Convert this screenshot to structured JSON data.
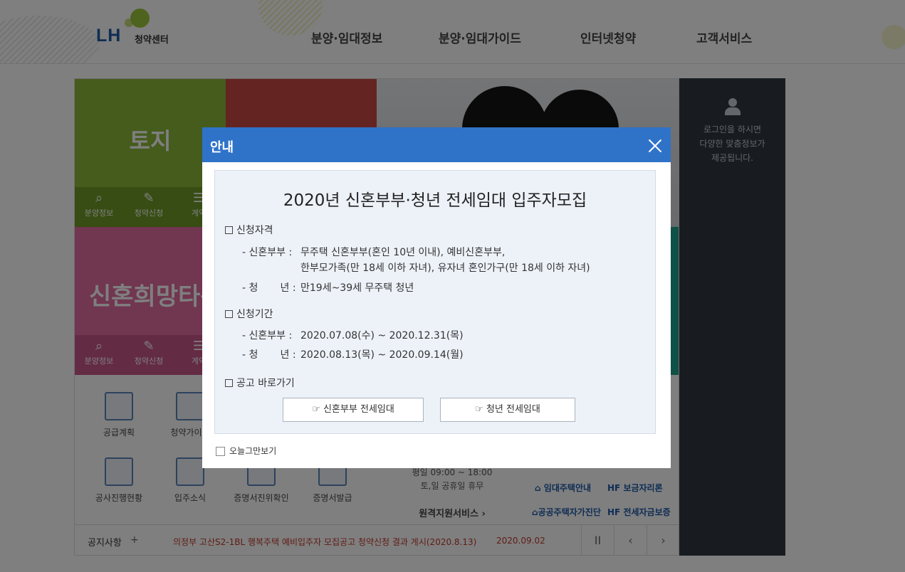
{
  "header": {
    "logo_mark": "LH",
    "logo_sub": "청약센터",
    "nav": [
      "분양·임대정보",
      "분양·임대가이드",
      "인터넷청약",
      "고객서비스"
    ]
  },
  "tiles": {
    "land_title": "토지",
    "newlywed_title": "신혼희망타운",
    "sub_buttons": [
      "분양정보",
      "청약신청",
      "계약"
    ]
  },
  "quick_links": [
    "공급계획",
    "청약가이드",
    "공사진행현황",
    "입주소식",
    "증명서진위확인",
    "증명서발급"
  ],
  "center_info": {
    "hours": "평일 09:00 ~ 18:00",
    "holiday": "토,일 공휴일 휴무",
    "remote": "원격지원서비스"
  },
  "services": [
    "임대주택안내",
    "보금자리론",
    "공공주택자가진단",
    "전세자금보증"
  ],
  "notice": {
    "label": "공지사항",
    "plus": "+",
    "text": "의정부 고산S2-1BL 행복주택 예비입주자 모집공고 청약신청 결과 게시(2020.8.13)",
    "date": "2020.09.02",
    "pause": "II",
    "prev": "‹",
    "next": "›"
  },
  "sidebar": {
    "login_msg": [
      "로그인을 하시면",
      "다양한 맞춤정보가",
      "제공됩니다."
    ]
  },
  "modal": {
    "title": "안내",
    "heading": "2020년 신혼부부·청년 전세임대 입주자모집",
    "sec_qualification": "신청자격",
    "qual_newlywed_label": "- 신혼부부 :",
    "qual_newlywed_line1": "무주택 신혼부부(혼인 10년 이내), 예비신혼부부,",
    "qual_newlywed_line2": "한부모가족(만 18세 이하 자녀), 유자녀 혼인가구(만 18세 이하 자녀)",
    "qual_youth_label": "- 청       년 :",
    "qual_youth_value": "만19세~39세 무주택 청년",
    "sec_period": "신청기간",
    "period_newlywed_label": "- 신혼부부 :",
    "period_newlywed_value": "2020.07.08(수) ~ 2020.12.31(목)",
    "period_youth_label": "- 청       년 :",
    "period_youth_value": "2020.08.13(목) ~ 2020.09.14(월)",
    "sec_links": "공고 바로가기",
    "btn_newlywed": "☞ 신혼부부 전세임대",
    "btn_youth": "☞ 청년 전세임대",
    "today_label": "오늘그만보기"
  }
}
